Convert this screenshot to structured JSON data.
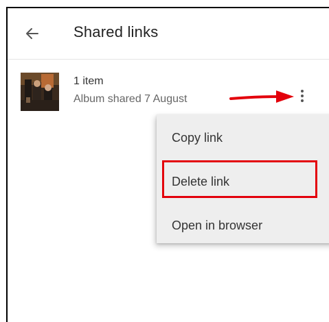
{
  "appbar": {
    "title": "Shared links",
    "back_icon": "arrow-left-icon"
  },
  "item": {
    "title": "1 item",
    "subtitle": "Album shared 7 August",
    "thumbnail_icon": "photo-thumbnail",
    "more_icon": "more-vertical-icon"
  },
  "menu": {
    "items": [
      {
        "label": "Copy link"
      },
      {
        "label": "Delete link"
      },
      {
        "label": "Open in browser"
      }
    ]
  },
  "annotations": {
    "arrow_color": "#e3000b",
    "highlight_color": "#e3000b"
  }
}
